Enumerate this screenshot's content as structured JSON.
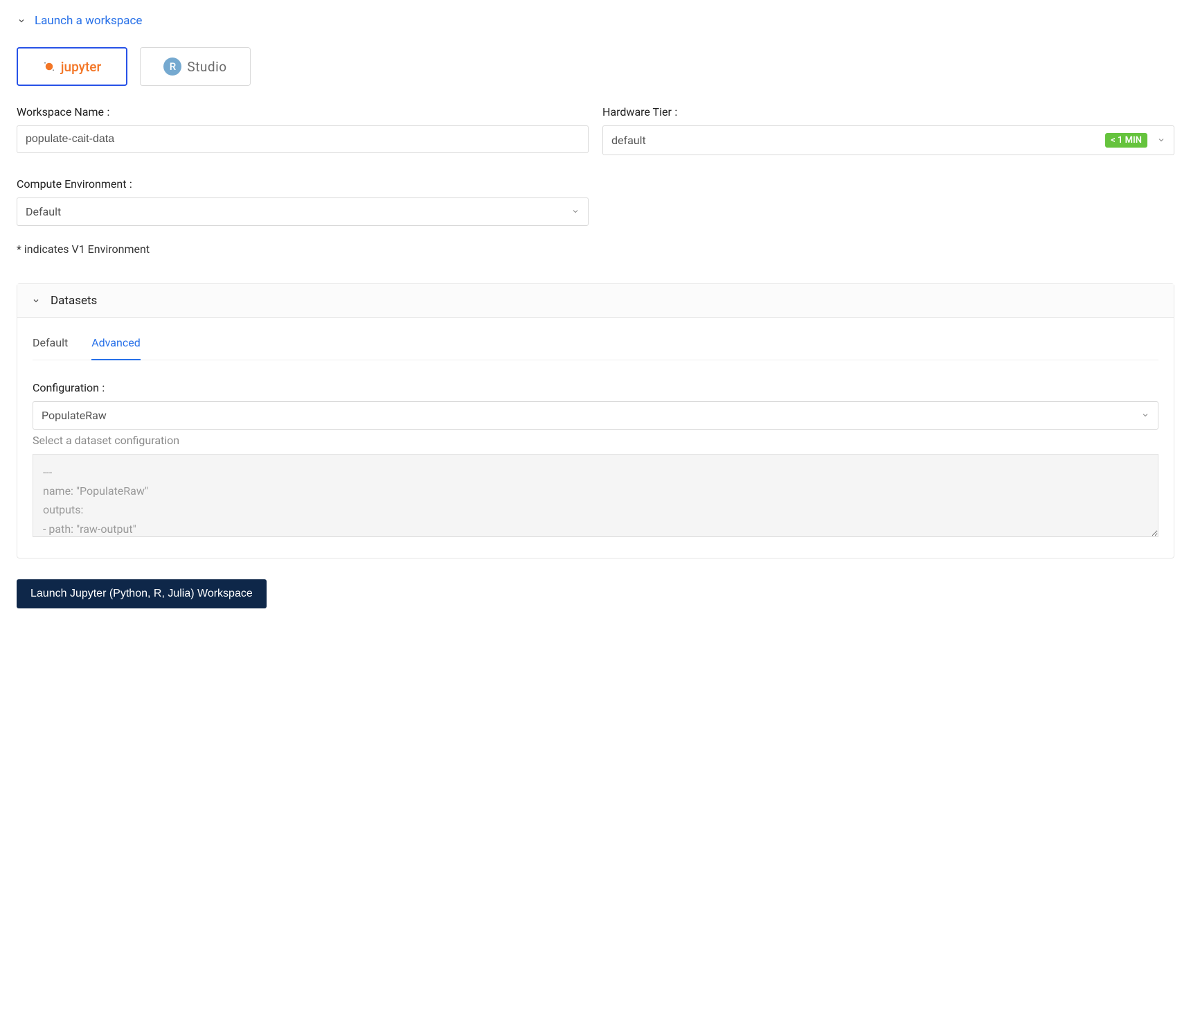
{
  "header": {
    "title": "Launch a workspace"
  },
  "tools": {
    "jupyter": "jupyter",
    "rstudio": "Studio",
    "r_badge": "R"
  },
  "form": {
    "workspace_name_label": "Workspace Name",
    "workspace_name_value": "populate-cait-data",
    "hardware_tier_label": "Hardware Tier",
    "hardware_tier_value": "default",
    "hardware_tier_badge": "< 1 MIN",
    "compute_env_label": "Compute Environment",
    "compute_env_value": "Default",
    "env_hint": "* indicates V1 Environment"
  },
  "datasets": {
    "panel_title": "Datasets",
    "tabs": {
      "default": "Default",
      "advanced": "Advanced"
    },
    "config_label": "Configuration",
    "config_value": "PopulateRaw",
    "config_hint": "Select a dataset configuration",
    "yaml": "---\nname: \"PopulateRaw\"\noutputs:\n- path: \"raw-output\""
  },
  "launch_button": "Launch Jupyter (Python, R, Julia) Workspace"
}
